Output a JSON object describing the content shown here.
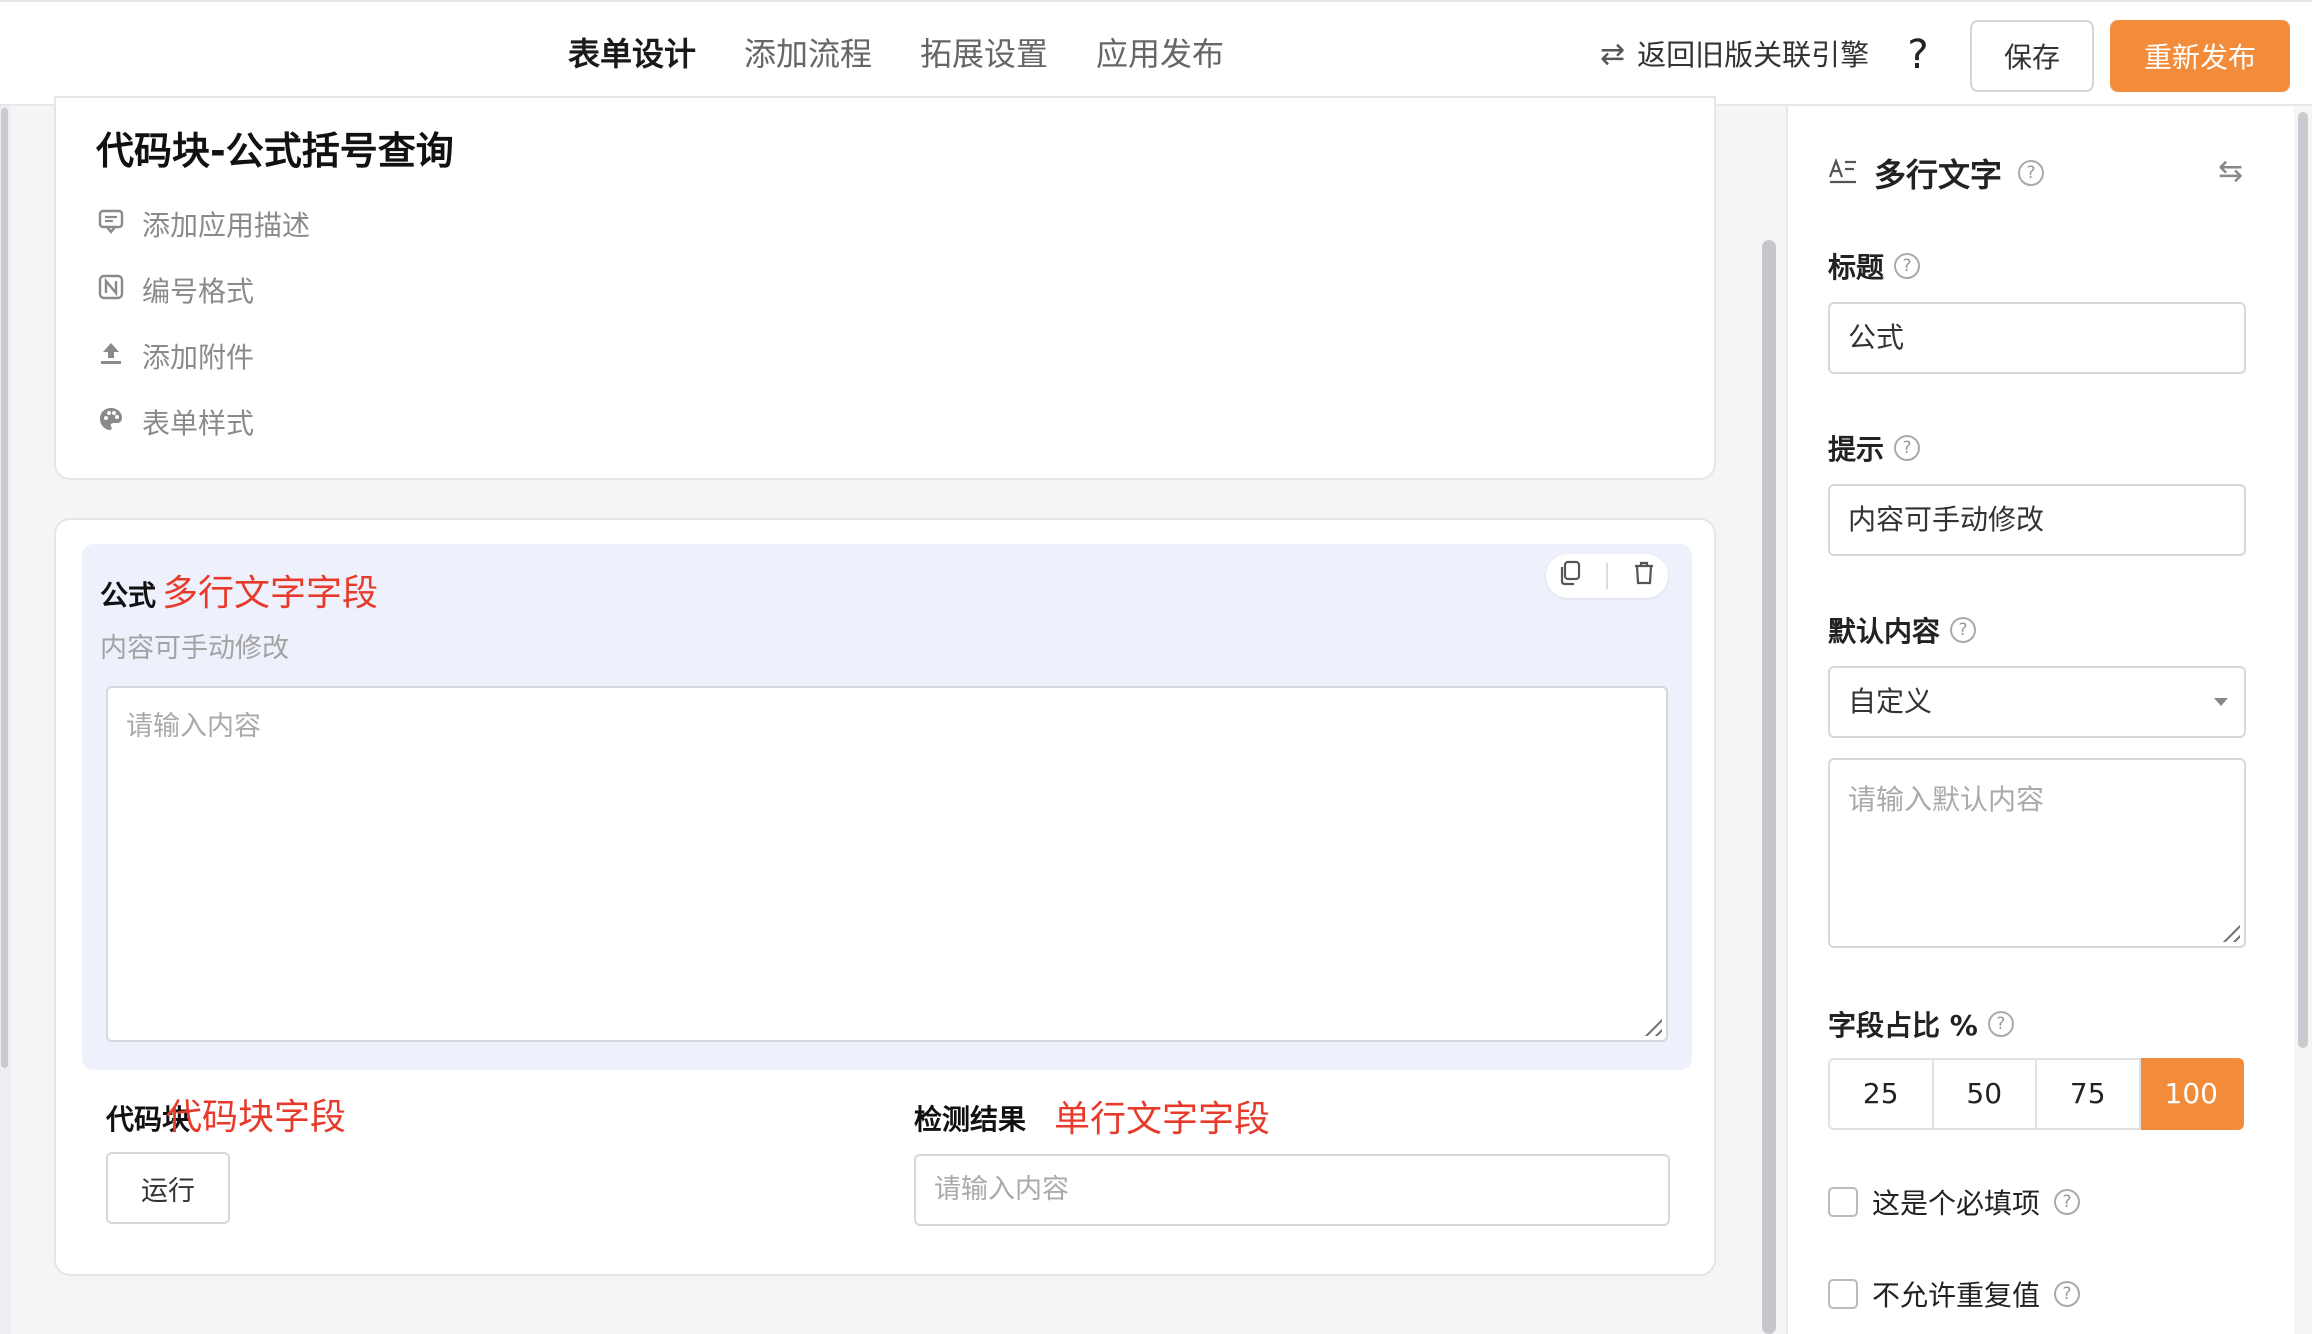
{
  "topbar": {
    "tabs": [
      {
        "label": "表单设计",
        "active": true
      },
      {
        "label": "添加流程",
        "active": false
      },
      {
        "label": "拓展设置",
        "active": false
      },
      {
        "label": "应用发布",
        "active": false
      }
    ],
    "legacy_link": "返回旧版关联引擎",
    "help": "?",
    "save_label": "保存",
    "publish_label": "重新发布",
    "accent_color": "#f28c3a"
  },
  "app": {
    "title": "代码块-公式括号查询",
    "meta": [
      {
        "icon": "comment-icon",
        "label": "添加应用描述"
      },
      {
        "icon": "number-format-icon",
        "label": "编号格式"
      },
      {
        "icon": "upload-icon",
        "label": "添加附件"
      },
      {
        "icon": "palette-icon",
        "label": "表单样式"
      }
    ]
  },
  "form": {
    "formula": {
      "label": "公式",
      "annotation": "多行文字字段",
      "hint": "内容可手动修改",
      "placeholder": "请输入内容"
    },
    "code_block": {
      "label": "代码块",
      "annotation": "代码块字段",
      "run_label": "运行"
    },
    "result": {
      "label": "检测结果",
      "annotation": "单行文字字段",
      "placeholder": "请输入内容"
    },
    "annotation_color": "#e83a2a"
  },
  "panel": {
    "field_type": "多行文字",
    "title_label": "标题",
    "title_value": "公式",
    "hint_label": "提示",
    "hint_value": "内容可手动修改",
    "default_label": "默认内容",
    "default_mode": "自定义",
    "default_placeholder": "请输入默认内容",
    "width_label": "字段占比 %",
    "width_options": [
      "25",
      "50",
      "75",
      "100"
    ],
    "width_selected": "100",
    "required_label": "这是个必填项",
    "unique_label": "不允许重复值"
  }
}
